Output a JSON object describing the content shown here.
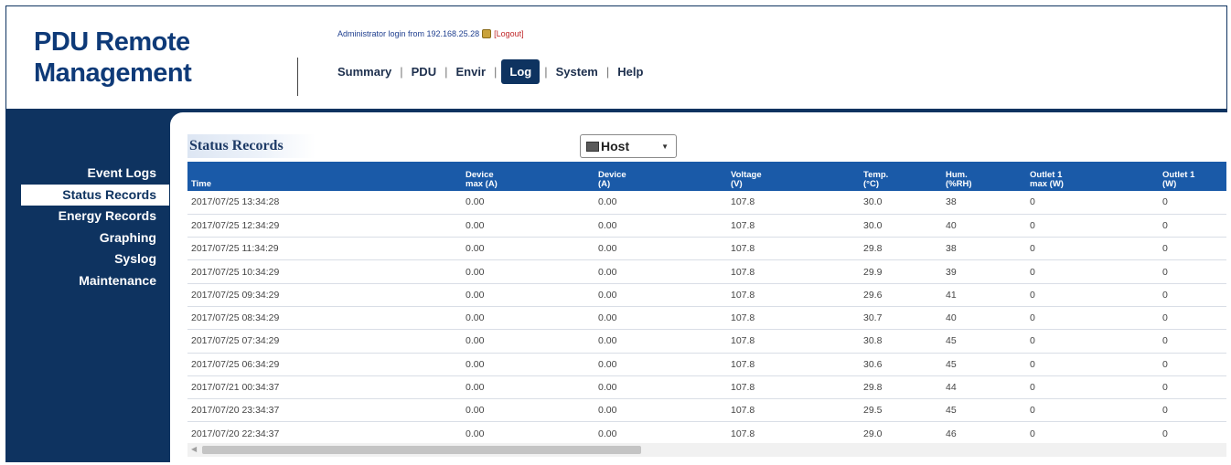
{
  "brand": {
    "line1": "PDU Remote",
    "line2": "Management"
  },
  "login": {
    "text": "Administrator login from 192.168.25.28",
    "logout": "[Logout]"
  },
  "topnav": [
    {
      "label": "Summary"
    },
    {
      "label": "PDU"
    },
    {
      "label": "Envir"
    },
    {
      "label": "Log",
      "active": true
    },
    {
      "label": "System"
    },
    {
      "label": "Help"
    }
  ],
  "sidebar": [
    {
      "label": "Event Logs"
    },
    {
      "label": "Status Records",
      "active": true
    },
    {
      "label": "Energy Records"
    },
    {
      "label": "Graphing"
    },
    {
      "label": "Syslog"
    },
    {
      "label": "Maintenance"
    }
  ],
  "section_title": "Status Records",
  "host_select": {
    "value": "Host"
  },
  "table": {
    "columns": [
      {
        "l1": "Time",
        "l2": ""
      },
      {
        "l1": "Device",
        "l2": "max (A)"
      },
      {
        "l1": "Device",
        "l2": "(A)"
      },
      {
        "l1": "Voltage",
        "l2": "(V)"
      },
      {
        "l1": "Temp.",
        "l2": "(°C)"
      },
      {
        "l1": "Hum.",
        "l2": "(%RH)"
      },
      {
        "l1": "Outlet 1",
        "l2": "max (W)"
      },
      {
        "l1": "Outlet 1",
        "l2": "(W)"
      }
    ],
    "rows": [
      [
        "2017/07/25 13:34:28",
        "0.00",
        "0.00",
        "107.8",
        "30.0",
        "38",
        "0",
        "0"
      ],
      [
        "2017/07/25 12:34:29",
        "0.00",
        "0.00",
        "107.8",
        "30.0",
        "40",
        "0",
        "0"
      ],
      [
        "2017/07/25 11:34:29",
        "0.00",
        "0.00",
        "107.8",
        "29.8",
        "38",
        "0",
        "0"
      ],
      [
        "2017/07/25 10:34:29",
        "0.00",
        "0.00",
        "107.8",
        "29.9",
        "39",
        "0",
        "0"
      ],
      [
        "2017/07/25 09:34:29",
        "0.00",
        "0.00",
        "107.8",
        "29.6",
        "41",
        "0",
        "0"
      ],
      [
        "2017/07/25 08:34:29",
        "0.00",
        "0.00",
        "107.8",
        "30.7",
        "40",
        "0",
        "0"
      ],
      [
        "2017/07/25 07:34:29",
        "0.00",
        "0.00",
        "107.8",
        "30.8",
        "45",
        "0",
        "0"
      ],
      [
        "2017/07/25 06:34:29",
        "0.00",
        "0.00",
        "107.8",
        "30.6",
        "45",
        "0",
        "0"
      ],
      [
        "2017/07/21 00:34:37",
        "0.00",
        "0.00",
        "107.8",
        "29.8",
        "44",
        "0",
        "0"
      ],
      [
        "2017/07/20 23:34:37",
        "0.00",
        "0.00",
        "107.8",
        "29.5",
        "45",
        "0",
        "0"
      ],
      [
        "2017/07/20 22:34:37",
        "0.00",
        "0.00",
        "107.8",
        "29.0",
        "46",
        "0",
        "0"
      ]
    ]
  },
  "colors": {
    "navy": "#0e3360",
    "header_blue": "#1a5aa8",
    "logout_red": "#c0282a"
  }
}
